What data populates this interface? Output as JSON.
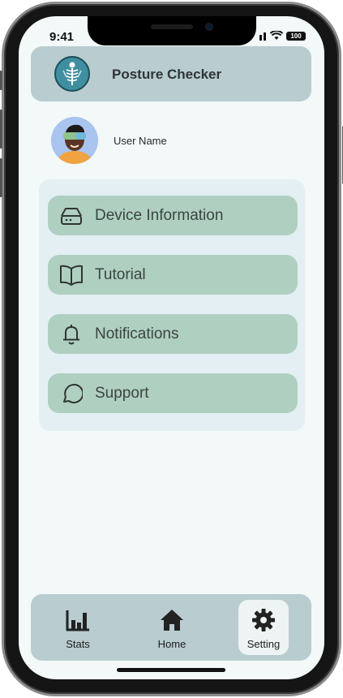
{
  "status_bar": {
    "time": "9:41",
    "battery": "100"
  },
  "app": {
    "title": "Posture Checker",
    "logo_icon": "posture-logo"
  },
  "profile": {
    "user_name": "User Name",
    "avatar_icon": "user-avatar"
  },
  "menu": {
    "items": [
      {
        "label": "Device Information",
        "icon": "harddrive-icon"
      },
      {
        "label": "Tutorial",
        "icon": "book-icon"
      },
      {
        "label": "Notifications",
        "icon": "bell-icon"
      },
      {
        "label": "Support",
        "icon": "chat-bubble-icon"
      }
    ]
  },
  "tab_bar": {
    "active": "Setting",
    "tabs": [
      {
        "label": "Stats",
        "icon": "bar-chart-icon"
      },
      {
        "label": "Home",
        "icon": "home-icon"
      },
      {
        "label": "Setting",
        "icon": "gear-icon"
      }
    ]
  },
  "colors": {
    "header_bg": "#b9cccf",
    "menu_item_bg": "#afd0c1",
    "menu_panel_bg": "#e3eff2",
    "screen_bg": "#f3f8f8"
  }
}
